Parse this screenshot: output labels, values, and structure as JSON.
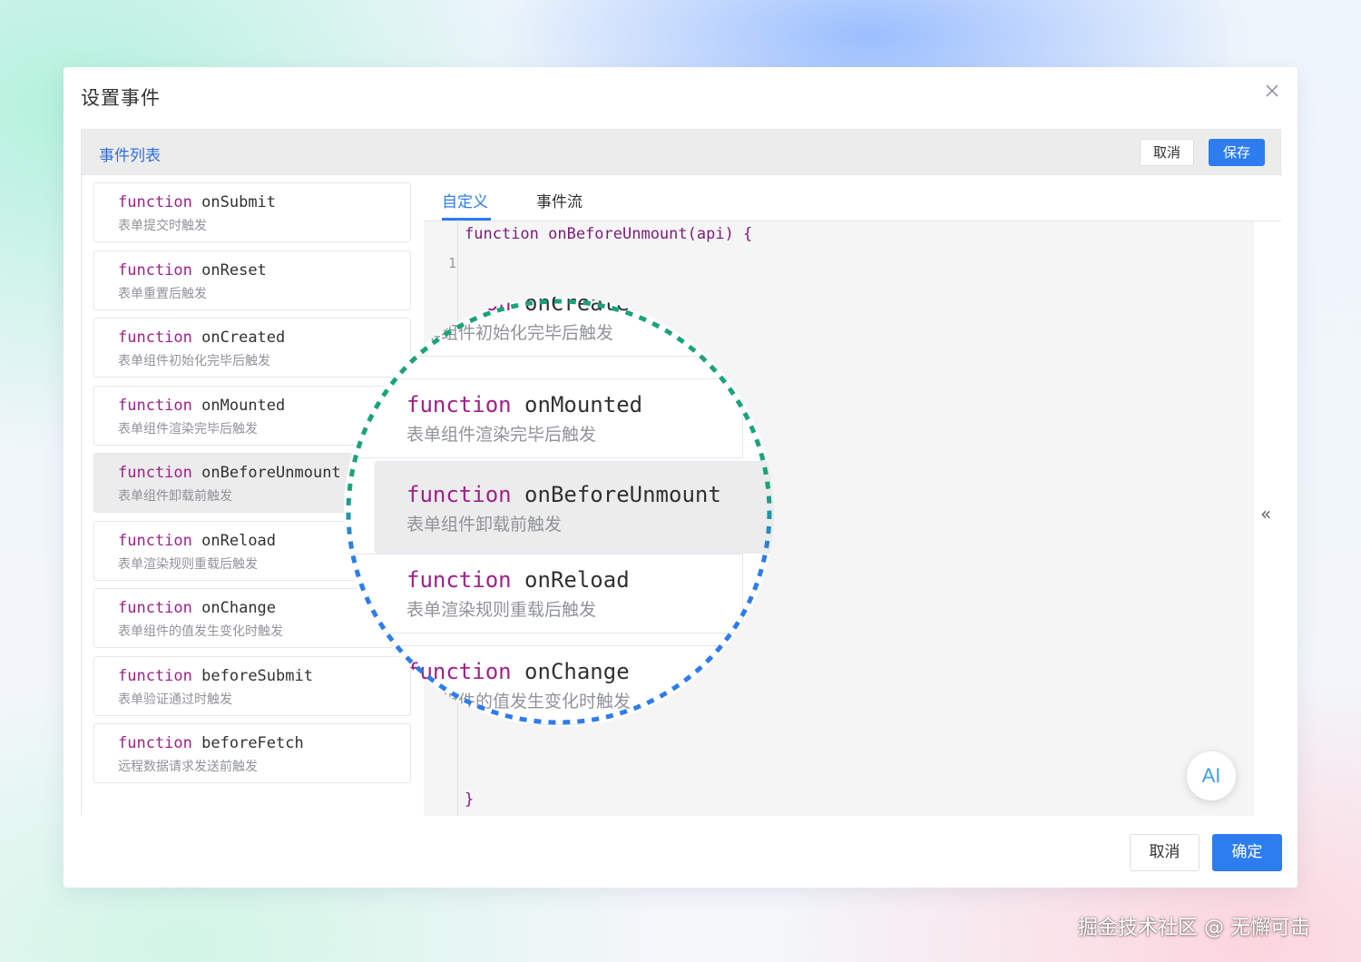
{
  "dialog": {
    "title": "设置事件",
    "footer": {
      "cancel_label": "取消",
      "confirm_label": "确定"
    }
  },
  "panel": {
    "title": "事件列表",
    "cancel_label": "取消",
    "save_label": "保存"
  },
  "events": [
    {
      "keyword": "function",
      "name": "onSubmit",
      "desc": "表单提交时触发"
    },
    {
      "keyword": "function",
      "name": "onReset",
      "desc": "表单重置后触发"
    },
    {
      "keyword": "function",
      "name": "onCreated",
      "desc": "表单组件初始化完毕后触发"
    },
    {
      "keyword": "function",
      "name": "onMounted",
      "desc": "表单组件渲染完毕后触发"
    },
    {
      "keyword": "function",
      "name": "onBeforeUnmount",
      "desc": "表单组件卸载前触发",
      "active": true
    },
    {
      "keyword": "function",
      "name": "onReload",
      "desc": "表单渲染规则重载后触发"
    },
    {
      "keyword": "function",
      "name": "onChange",
      "desc": "表单组件的值发生变化时触发"
    },
    {
      "keyword": "function",
      "name": "beforeSubmit",
      "desc": "表单验证通过时触发"
    },
    {
      "keyword": "function",
      "name": "beforeFetch",
      "desc": "远程数据请求发送前触发"
    }
  ],
  "tabs": [
    {
      "label": "自定义",
      "active": true
    },
    {
      "label": "事件流",
      "active": false
    }
  ],
  "editor": {
    "first_line": "function onBeforeUnmount(api) {",
    "line_number": "1",
    "last_line": "}",
    "collapse_icon": "«",
    "ai_label": "AI"
  },
  "magnifier": {
    "items": [
      {
        "keyword": "function",
        "name": "onCreated",
        "desc": "表单组件初始化完毕后触发"
      },
      {
        "keyword": "function",
        "name": "onMounted",
        "desc": "表单组件渲染完毕后触发"
      },
      {
        "keyword": "function",
        "name": "onBeforeUnmount",
        "desc": "表单组件卸载前触发",
        "active": true
      },
      {
        "keyword": "function",
        "name": "onReload",
        "desc": "表单渲染规则重载后触发"
      },
      {
        "keyword": "function",
        "name": "onChange",
        "desc": "表单组件的值发生变化时触发"
      }
    ]
  },
  "icons": {
    "close": "close-icon",
    "collapse": "double-chevron-left-icon"
  },
  "colors": {
    "primary": "#2d7cf0",
    "keyword": "#a0208a",
    "ring_green": "#1aa37a",
    "ring_blue": "#2d7cf0"
  },
  "watermark": "掘金技术社区 @ 无懈可击"
}
